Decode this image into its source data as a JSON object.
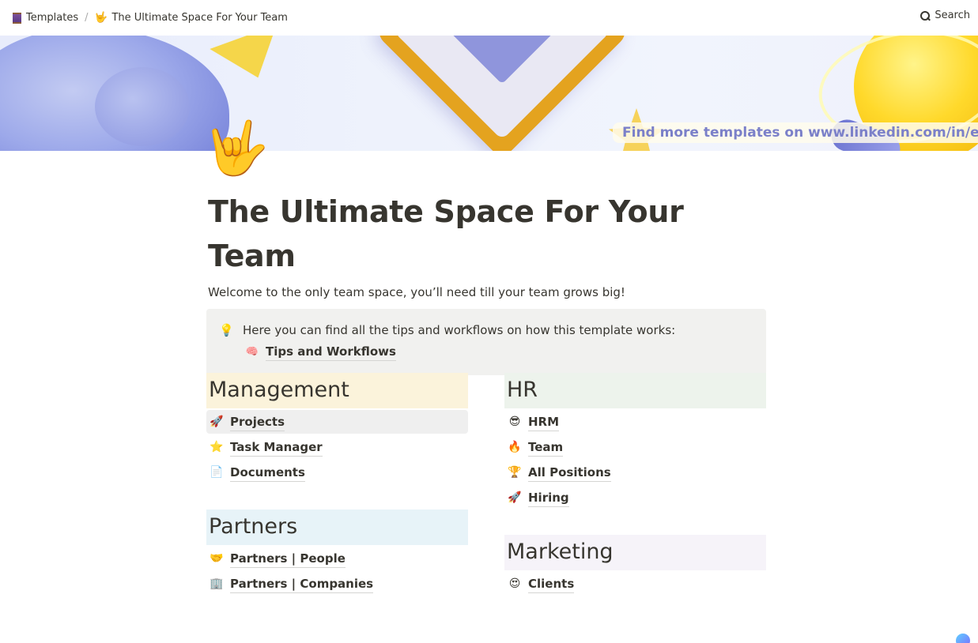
{
  "topbar": {
    "breadcrumbs": [
      {
        "icon": "spool-icon",
        "label": "Templates"
      },
      {
        "icon": "🤟",
        "label": "The Ultimate Space For Your Team"
      }
    ],
    "separator": "/",
    "search_label": "Search"
  },
  "cover": {
    "banner_text": "Find more templates on www.linkedin.com/in/elen"
  },
  "page": {
    "icon": "🤟",
    "title": "The Ultimate Space For Your Team",
    "subtitle": "Welcome to the only team space, you’ll need till your team grows big!"
  },
  "callout": {
    "icon": "💡",
    "text": "Here you can find all the tips and workflows on how this template works:",
    "link": {
      "icon": "🧠",
      "label": "Tips and Workflows"
    }
  },
  "sections": {
    "management": {
      "title": "Management",
      "color": "#fbf3db",
      "items": [
        {
          "icon": "🚀",
          "label": "Projects"
        },
        {
          "icon": "⭐",
          "label": "Task Manager"
        },
        {
          "icon": "📄",
          "label": "Documents"
        }
      ]
    },
    "partners": {
      "title": "Partners",
      "color": "#e7f3f8",
      "items": [
        {
          "icon": "🤝",
          "label": "Partners | People"
        },
        {
          "icon": "🏢",
          "label": "Partners | Companies"
        }
      ]
    },
    "hr": {
      "title": "HR",
      "color": "#edf3ec",
      "items": [
        {
          "icon": "😎",
          "label": "HRM"
        },
        {
          "icon": "🔥",
          "label": "Team"
        },
        {
          "icon": "🏆",
          "label": "All Positions"
        },
        {
          "icon": "🚀",
          "label": "Hiring"
        }
      ]
    },
    "marketing": {
      "title": "Marketing",
      "color": "#f6f3f9",
      "items": [
        {
          "icon": "😍",
          "label": "Clients"
        }
      ]
    }
  }
}
